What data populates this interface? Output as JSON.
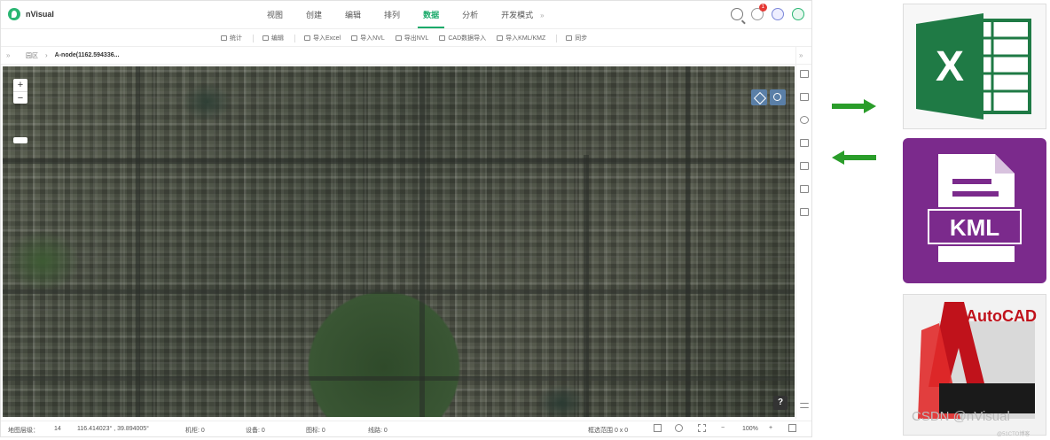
{
  "app": {
    "name": "nVisual"
  },
  "menu": {
    "items": [
      "视图",
      "创建",
      "编辑",
      "排列",
      "数据",
      "分析",
      "开发模式"
    ],
    "active": "数据",
    "extra": "»"
  },
  "notifications": {
    "count": "1"
  },
  "toolbar": {
    "items": [
      "统计",
      "编辑",
      "导入Excel",
      "导入NVL",
      "导出NVL",
      "CAD数据导入",
      "导入KML/KMZ",
      "同步"
    ]
  },
  "breadcrumb": {
    "root": "园区",
    "node": "A-node(1162.594336..."
  },
  "map": {
    "zoom_in": "+",
    "zoom_out": "−",
    "help": "?"
  },
  "status": {
    "level_label": "地图层级：",
    "level_value": "14",
    "coords": "116.414023° , 39.894005°",
    "cabinets": "机柜: 0",
    "devices": "设备: 0",
    "icons": "图标: 0",
    "lines": "线路: 0",
    "selection": "框选范围 0 x 0",
    "zoom": "100%"
  },
  "right_panel": {
    "excel_letter": "X",
    "kml_label": "KML",
    "autocad_label": "AutoCAD"
  },
  "colors": {
    "accent": "#1aaa6a",
    "arrow_green": "#2a9d2a",
    "excel_green": "#1f7a45",
    "kml_purple": "#7b2a8c",
    "autocad_red": "#c0121b"
  },
  "watermark": {
    "text": "CSDN @nVisual",
    "sub": "@51CTO博客"
  }
}
